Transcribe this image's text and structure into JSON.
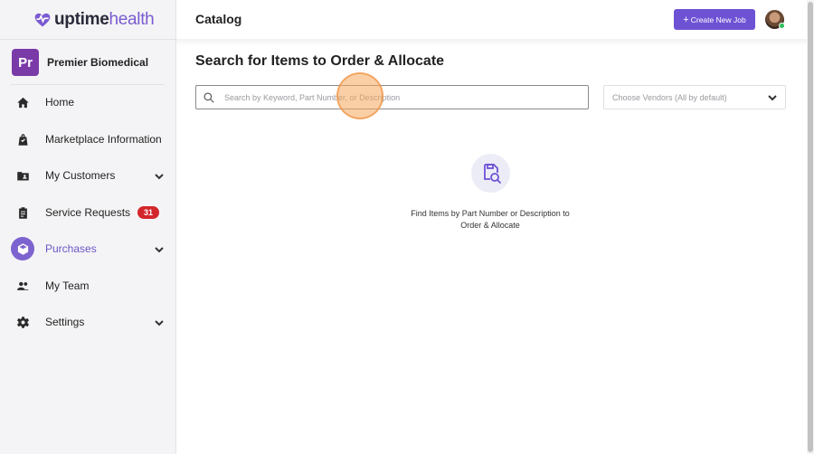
{
  "brand": {
    "name_part1": "uptime",
    "name_part2": "health",
    "mark_color": "#7a5bd0"
  },
  "organization": {
    "initials": "Pr",
    "name": "Premier Biomedical"
  },
  "sidebar": {
    "items": [
      {
        "label": "Home",
        "icon": "home-icon"
      },
      {
        "label": "Marketplace Information",
        "icon": "shopping-bag-icon"
      },
      {
        "label": "My Customers",
        "icon": "contacts-folder-icon"
      },
      {
        "label": "Service Requests",
        "icon": "clipboard-icon",
        "badge": "31"
      },
      {
        "label": "Purchases",
        "icon": "package-icon"
      },
      {
        "label": "My Team",
        "icon": "people-icon"
      },
      {
        "label": "Settings",
        "icon": "gear-icon"
      }
    ]
  },
  "header": {
    "title": "Catalog",
    "create_label": "Create New Job"
  },
  "main": {
    "title": "Search for Items to Order & Allocate",
    "search_placeholder": "Search by Keyword, Part Number, or Description",
    "vendor_placeholder": "Choose Vendors (All by default)",
    "empty_line1": "Find Items by Part Number or Description to",
    "empty_line2": "Order & Allocate"
  },
  "colors": {
    "accent": "#6e52d4",
    "badge": "#d3262b",
    "online": "#2bbf5a"
  }
}
